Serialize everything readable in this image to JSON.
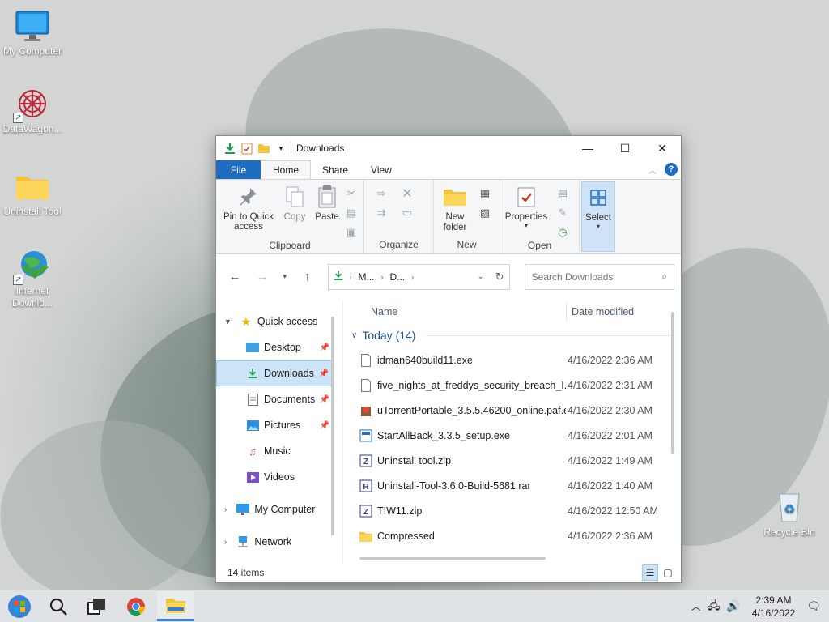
{
  "desktop": {
    "icons": [
      {
        "label": "My Computer"
      },
      {
        "label": "DataWagon..."
      },
      {
        "label": "Uninstall Tool"
      },
      {
        "label": "Internet Downlo..."
      },
      {
        "label": "Recycle Bin"
      }
    ]
  },
  "window": {
    "title": "Downloads",
    "menu_tabs": [
      "File",
      "Home",
      "Share",
      "View"
    ],
    "ribbon": {
      "clipboard": {
        "label": "Clipboard",
        "pin": "Pin to Quick access",
        "copy": "Copy",
        "paste": "Paste"
      },
      "organize": {
        "label": "Organize"
      },
      "new": {
        "label": "New",
        "new_folder": "New folder"
      },
      "open": {
        "label": "Open",
        "properties": "Properties"
      },
      "select": {
        "label": "Select"
      }
    },
    "address": {
      "seg1": "M...",
      "seg2": "D..."
    },
    "search": {
      "placeholder": "Search Downloads"
    },
    "nav": {
      "quick_access": "Quick access",
      "desktop": "Desktop",
      "downloads": "Downloads",
      "documents": "Documents",
      "pictures": "Pictures",
      "music": "Music",
      "videos": "Videos",
      "my_computer": "My Computer",
      "network": "Network"
    },
    "columns": {
      "name": "Name",
      "date": "Date modified"
    },
    "group": "Today (14)",
    "files": [
      {
        "name": "idman640build11.exe",
        "date": "4/16/2022 2:36 AM"
      },
      {
        "name": "five_nights_at_freddys_security_breach_I....",
        "date": "4/16/2022 2:31 AM"
      },
      {
        "name": "uTorrentPortable_3.5.5.46200_online.paf.e...",
        "date": "4/16/2022 2:30 AM"
      },
      {
        "name": "StartAllBack_3.3.5_setup.exe",
        "date": "4/16/2022 2:01 AM"
      },
      {
        "name": "Uninstall tool.zip",
        "date": "4/16/2022 1:49 AM"
      },
      {
        "name": "Uninstall-Tool-3.6.0-Build-5681.rar",
        "date": "4/16/2022 1:40 AM"
      },
      {
        "name": "TIW11.zip",
        "date": "4/16/2022 12:50 AM"
      },
      {
        "name": "Compressed",
        "date": "4/16/2022 2:36 AM"
      }
    ],
    "status": "14 items"
  },
  "taskbar": {
    "time": "2:39 AM",
    "date": "4/16/2022"
  },
  "colors": {
    "accent": "#1e6dc0",
    "selection": "#cce4f7"
  }
}
